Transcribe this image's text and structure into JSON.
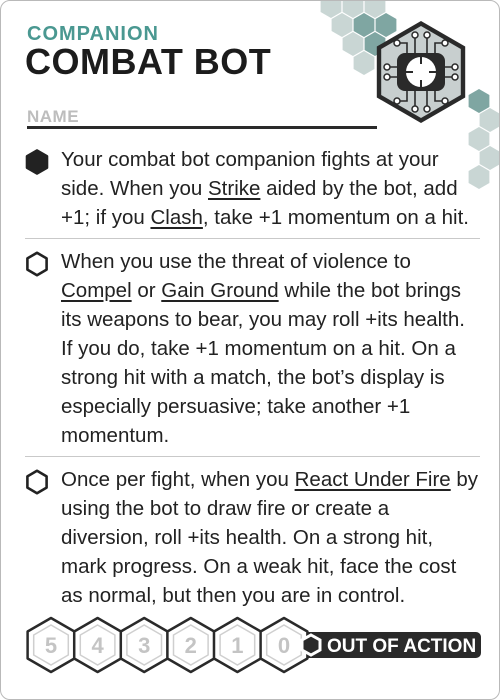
{
  "card": {
    "category": "COMPANION",
    "title": "COMBAT BOT",
    "name_label": "NAME"
  },
  "abilities": [
    {
      "marked": true,
      "parts": [
        "Your combat bot companion fights at your side. When you ",
        "Strike",
        " aided by the bot, add +1; if you ",
        "Clash",
        ", take +1 momentum on a hit."
      ]
    },
    {
      "marked": false,
      "parts": [
        "When you use the threat of violence to ",
        "Compel",
        " or ",
        "Gain Ground",
        " while the bot brings its weapons to bear, you may roll +its health. If you do, take +1 momentum on a hit. On a strong hit with a match, the bot’s display is especially persuasive; take another +1 momentum."
      ]
    },
    {
      "marked": false,
      "parts": [
        "Once per fight, when you ",
        "React Under Fire",
        " by using the bot to draw fire or create a diversion, roll +its health. On a strong hit, mark progress. On a weak hit, face the cost as normal, but then you are in control."
      ]
    }
  ],
  "health_track": {
    "values": [
      "5",
      "4",
      "3",
      "2",
      "1",
      "0"
    ],
    "out_label": "OUT OF ACTION"
  },
  "colors": {
    "accent": "#4a9891",
    "dark": "#2a2a2a",
    "muted": "#bdbdbd",
    "deco_hex": "#c9d6d4",
    "deco_hex_mid": "#7fa6a2"
  },
  "icon": "circuit-reticle-hex-icon"
}
